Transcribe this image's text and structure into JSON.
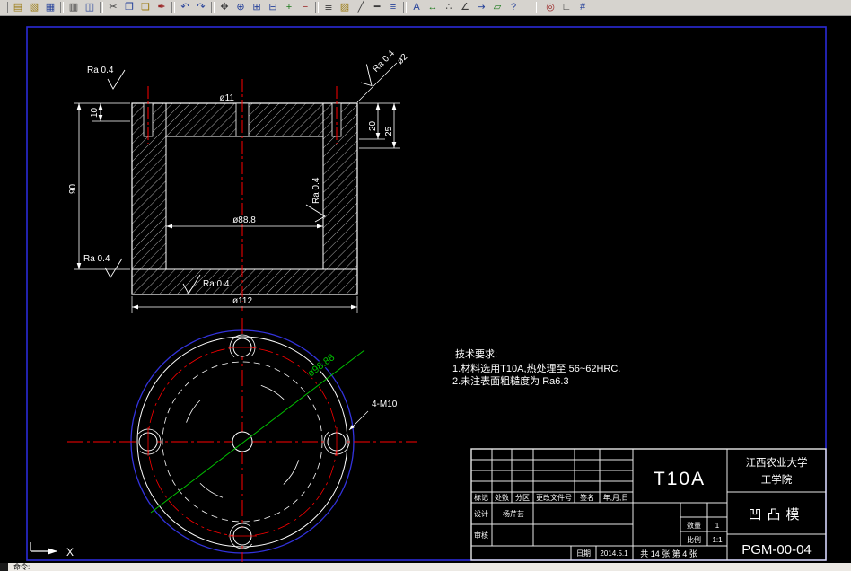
{
  "toolbar": {
    "icons": [
      {
        "name": "new",
        "glyph": "▤"
      },
      {
        "name": "open",
        "glyph": "▧"
      },
      {
        "name": "save",
        "glyph": "▦"
      },
      {
        "name": "print",
        "glyph": "▥"
      },
      {
        "name": "print-preview",
        "glyph": "◫"
      },
      {
        "name": "cut",
        "glyph": "✂"
      },
      {
        "name": "copy",
        "glyph": "❐"
      },
      {
        "name": "paste",
        "glyph": "❏"
      },
      {
        "name": "match-properties",
        "glyph": "✒"
      },
      {
        "name": "undo",
        "glyph": "↶"
      },
      {
        "name": "redo",
        "glyph": "↷"
      },
      {
        "name": "pan",
        "glyph": "✥"
      },
      {
        "name": "zoom-realtime",
        "glyph": "⊕"
      },
      {
        "name": "zoom-window",
        "glyph": "⊞"
      },
      {
        "name": "zoom-previous",
        "glyph": "⊟"
      },
      {
        "name": "zoom-in",
        "glyph": "+"
      },
      {
        "name": "zoom-out",
        "glyph": "−"
      },
      {
        "name": "layers",
        "glyph": "≣"
      },
      {
        "name": "layer-color",
        "glyph": "▨"
      },
      {
        "name": "linetype",
        "glyph": "╱"
      },
      {
        "name": "lineweight",
        "glyph": "━"
      },
      {
        "name": "properties",
        "glyph": "≡"
      },
      {
        "name": "text-style",
        "glyph": "A"
      },
      {
        "name": "dim-style",
        "glyph": "↔"
      },
      {
        "name": "point-style",
        "glyph": "∴"
      },
      {
        "name": "units",
        "glyph": "∠"
      },
      {
        "name": "distance",
        "glyph": "↦"
      },
      {
        "name": "area",
        "glyph": "▱"
      },
      {
        "name": "help",
        "glyph": "?"
      },
      {
        "name": "osnap",
        "glyph": "◎"
      },
      {
        "name": "ortho",
        "glyph": "∟"
      },
      {
        "name": "grid",
        "glyph": "#"
      }
    ]
  },
  "drawing": {
    "section": {
      "ra_top_left": "Ra 0.4",
      "dim_10": "10",
      "dim_90": "90",
      "ra_left_bottom": "Ra 0.4",
      "ra_bottom": "Ra 0.4",
      "dia_112": "ø112",
      "dia_88": "ø88.8",
      "dia_11": "ø11",
      "ra_inner_right": "Ra 0.4",
      "ra_top_right": "Ra 0.4",
      "dia_2": "ø2",
      "dim_20": "20",
      "dim_25": "25"
    },
    "plan": {
      "dia_9888": "ø98.88",
      "holes_label": "4-M10"
    },
    "notes": {
      "title": "技术要求:",
      "line1": "1.材料选用T10A,热处理至 56~62HRC.",
      "line2": "2.未注表面粗糙度为 Ra6.3"
    },
    "ucs_x": "X"
  },
  "title_block": {
    "material": "T10A",
    "org_line1": "江西农业大学",
    "org_line2": "工学院",
    "part_name": "凹凸模",
    "drawing_no": "PGM-00-04",
    "col_mark": "标记",
    "col_count": "处数",
    "col_zone": "分区",
    "col_change": "更改文件号",
    "col_sign": "签名",
    "col_date": "年,月,日",
    "design_label": "设计",
    "designer": "杨芹芸",
    "audit_label": "审核",
    "date_label": "日期",
    "date_value": "2014.5.1",
    "qty_label": "数量",
    "qty_value": "1",
    "scale_label": "比例",
    "scale_value": "1:1",
    "sheet_info": "共 14 张 第 4 张"
  },
  "command": {
    "prompt": "命令:"
  }
}
